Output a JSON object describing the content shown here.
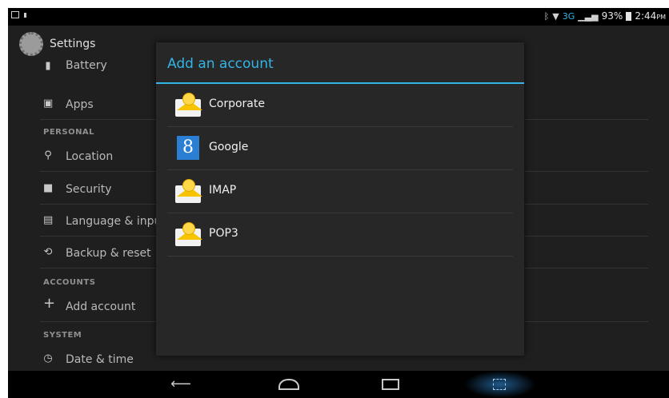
{
  "status_bar": {
    "network": "3G",
    "battery_percent": "93%",
    "time": "2:44",
    "time_suffix": "PM"
  },
  "settings": {
    "title": "Settings",
    "items": [
      {
        "label": "Battery",
        "icon": "battery-icon"
      },
      {
        "label": "Apps",
        "icon": "apps-icon"
      },
      {
        "label": "Location",
        "icon": "location-pin-icon"
      },
      {
        "label": "Security",
        "icon": "lock-icon"
      },
      {
        "label": "Language & input",
        "icon": "keyboard-icon"
      },
      {
        "label": "Backup & reset",
        "icon": "backup-icon"
      },
      {
        "label": "Add account",
        "icon": "plus-icon"
      },
      {
        "label": "Date & time",
        "icon": "clock-icon"
      }
    ],
    "sections": {
      "personal": "PERSONAL",
      "accounts": "ACCOUNTS",
      "system": "SYSTEM"
    }
  },
  "dialog": {
    "title": "Add an account",
    "options": [
      {
        "label": "Corporate",
        "icon": "email-envelope-icon"
      },
      {
        "label": "Google",
        "icon": "google-icon"
      },
      {
        "label": "IMAP",
        "icon": "email-envelope-icon"
      },
      {
        "label": "POP3",
        "icon": "email-envelope-icon"
      }
    ]
  },
  "colors": {
    "accent": "#33b5e5",
    "background": "#1f1f1f",
    "dialog_bg": "#272727"
  }
}
